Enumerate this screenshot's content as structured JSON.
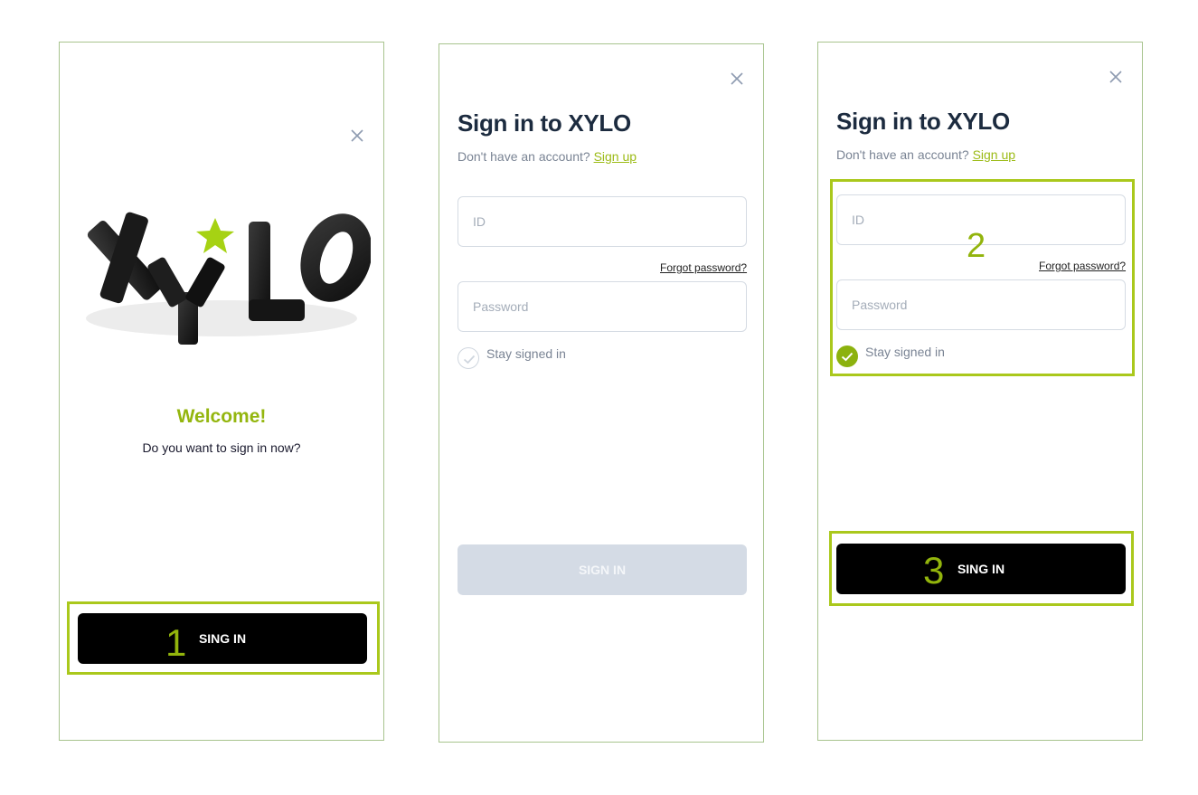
{
  "screen1": {
    "welcome": "Welcome!",
    "prompt": "Do you want to sign in now?",
    "button": "SING IN",
    "step": "1"
  },
  "screen2": {
    "title": "Sign in to XYLO",
    "no_account": "Don't have an account?",
    "signup": "Sign up",
    "id_placeholder": "ID",
    "forgot": "Forgot password?",
    "password_placeholder": "Password",
    "stay": "Stay signed in",
    "button": "SIGN IN"
  },
  "screen3": {
    "title": "Sign in to XYLO",
    "no_account": "Don't have an account?",
    "signup": "Sign up",
    "id_placeholder": "ID",
    "forgot": "Forgot password?",
    "password_placeholder": "Password",
    "stay": "Stay signed in",
    "button": "SING IN",
    "step_form": "2",
    "step_button": "3"
  },
  "colors": {
    "accent": "#94b60f",
    "highlight": "#aac81c",
    "frame": "#a8c48e",
    "button": "#000000",
    "button_disabled": "#d4dbe5"
  },
  "icons": [
    "close-icon",
    "check-icon",
    "xylo-logo"
  ]
}
